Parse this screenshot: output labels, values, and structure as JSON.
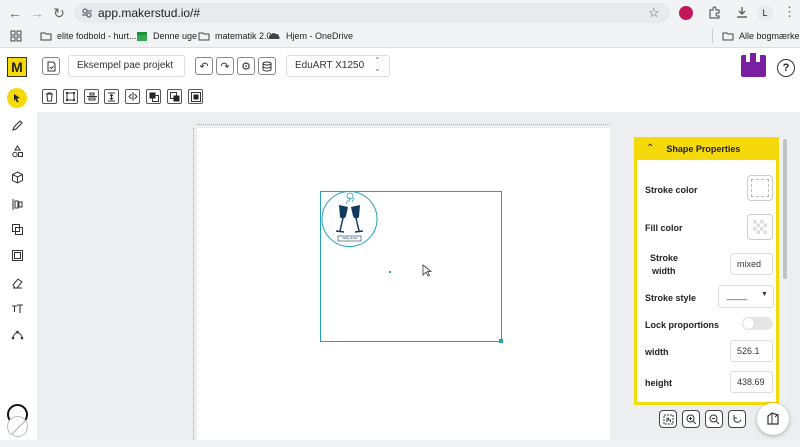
{
  "browser": {
    "url": "app.makerstud.io/#",
    "profile_initial": "L",
    "bookmarks": [
      {
        "label": "elite fodbold - hurt...",
        "icon": "folder-icon"
      },
      {
        "label": "Denne uge",
        "icon": "calendar-icon"
      },
      {
        "label": "matematik 2.0",
        "icon": "folder-icon"
      },
      {
        "label": "Hjem - OneDrive",
        "icon": "onedrive-icon"
      }
    ],
    "all_bookmarks_label": "Alle bogmærker"
  },
  "app": {
    "logo_letter": "M",
    "project_name": "Eksempel pae projekt",
    "machine": "EduART X1250",
    "help_glyph": "?"
  },
  "panel": {
    "title": "Shape Properties",
    "stroke_color_label": "Stroke color",
    "fill_color_label": "Fill color",
    "stroke_width_label_line1": "Stroke",
    "stroke_width_label_line2": "width",
    "stroke_width_value": "mixed",
    "stroke_style_label": "Stroke style",
    "stroke_style_value": "____",
    "lock_proportions_label": "Lock proportions",
    "lock_proportions_on": false,
    "width_label": "width",
    "width_value": "526.1",
    "height_label": "height",
    "height_value": "438.69"
  },
  "design": {
    "badge_text": "Skål på det"
  },
  "colors": {
    "accent_yellow": "#f5d90a",
    "logo_purple": "#7b1fa2",
    "selection_teal": "#26a0b8"
  }
}
